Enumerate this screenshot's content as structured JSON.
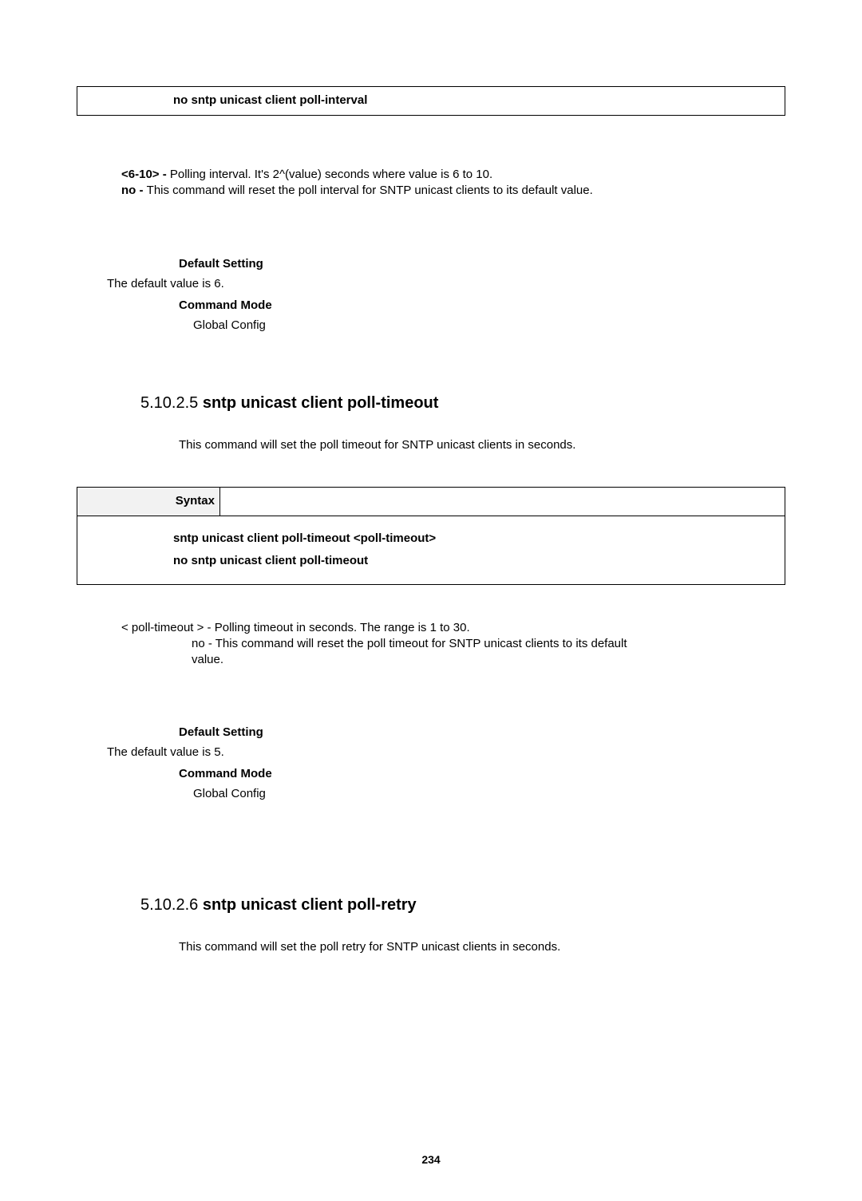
{
  "top_box": {
    "line": "no sntp unicast client poll-interval"
  },
  "params1": {
    "p1_bold": "<6-10> - ",
    "p1_text": "Polling interval. It's 2^(value) seconds where value is 6 to 10.",
    "p2_bold": "no - ",
    "p2_text": "This command will reset the poll interval for SNTP unicast clients to its default value."
  },
  "ds1": {
    "heading": "Default Setting",
    "value": "The default value is 6.",
    "mode_heading": "Command Mode",
    "mode_value": "Global Config"
  },
  "section_5": {
    "num": "5.10.2.5 ",
    "name": "sntp unicast client poll-timeout",
    "desc": "This command will set the poll timeout for SNTP unicast clients in seconds."
  },
  "syntax": {
    "label": "Syntax",
    "line1": "sntp unicast client poll-timeout <poll-timeout>",
    "line2": "no sntp unicast client poll-timeout"
  },
  "params2": {
    "p1_bold": "< poll-timeout > - ",
    "p1_text": "Polling timeout in seconds. The range is 1 to 30.",
    "p2_bold": "no - ",
    "p2_text": "This command will reset the poll timeout for SNTP unicast clients to its default ",
    "p2_text_line2": "value."
  },
  "ds2": {
    "heading": "Default Setting",
    "value": "The default value is 5.",
    "mode_heading": "Command Mode",
    "mode_value": "Global Config"
  },
  "section_6": {
    "num": "5.10.2.6 ",
    "name": "sntp unicast client poll-retry",
    "desc": "This command will set the poll retry for SNTP unicast clients in seconds."
  },
  "page_number": "234"
}
